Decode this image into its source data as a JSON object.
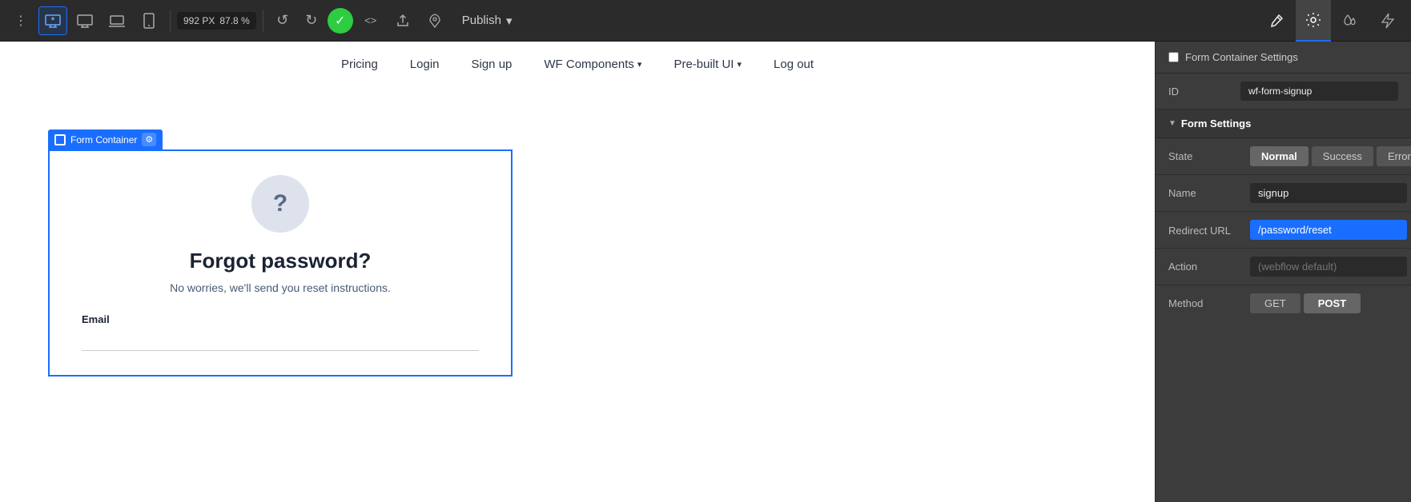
{
  "toolbar": {
    "size_px": "992 PX",
    "zoom": "87.8 %",
    "publish_label": "Publish",
    "device_icons": [
      "desktop-starred-icon",
      "desktop-icon",
      "laptop-icon",
      "tablet-icon"
    ],
    "undo_symbol": "↺",
    "redo_symbol": "↻",
    "code_symbol": "<>",
    "export_symbol": "↗",
    "rocket_symbol": "🚀",
    "rt_icons": [
      "brush-icon",
      "settings-icon",
      "drops-icon",
      "lightning-icon"
    ]
  },
  "canvas": {
    "nav": {
      "items": [
        {
          "label": "Pricing",
          "dropdown": false
        },
        {
          "label": "Login",
          "dropdown": false
        },
        {
          "label": "Sign up",
          "dropdown": false
        },
        {
          "label": "WF Components",
          "dropdown": true
        },
        {
          "label": "Pre-built UI",
          "dropdown": true
        },
        {
          "label": "Log out",
          "dropdown": false
        }
      ]
    },
    "form_container": {
      "label": "Form Container",
      "icon_symbol": "?",
      "title": "Forgot password?",
      "subtitle": "No worries, we'll send you reset instructions.",
      "email_label": "Email"
    }
  },
  "right_panel": {
    "form_container_settings_label": "Form Container Settings",
    "id_label": "ID",
    "id_value": "wf-form-signup",
    "form_settings_label": "Form Settings",
    "state_label": "State",
    "state_options": [
      {
        "label": "Normal",
        "active": true
      },
      {
        "label": "Success",
        "active": false
      },
      {
        "label": "Error",
        "active": false
      }
    ],
    "name_label": "Name",
    "name_value": "signup",
    "redirect_url_label": "Redirect URL",
    "redirect_url_value": "/password/reset",
    "action_label": "Action",
    "action_placeholder": "(webflow default)",
    "method_label": "Method",
    "method_options": [
      {
        "label": "GET",
        "active": false
      },
      {
        "label": "POST",
        "active": true
      }
    ]
  }
}
